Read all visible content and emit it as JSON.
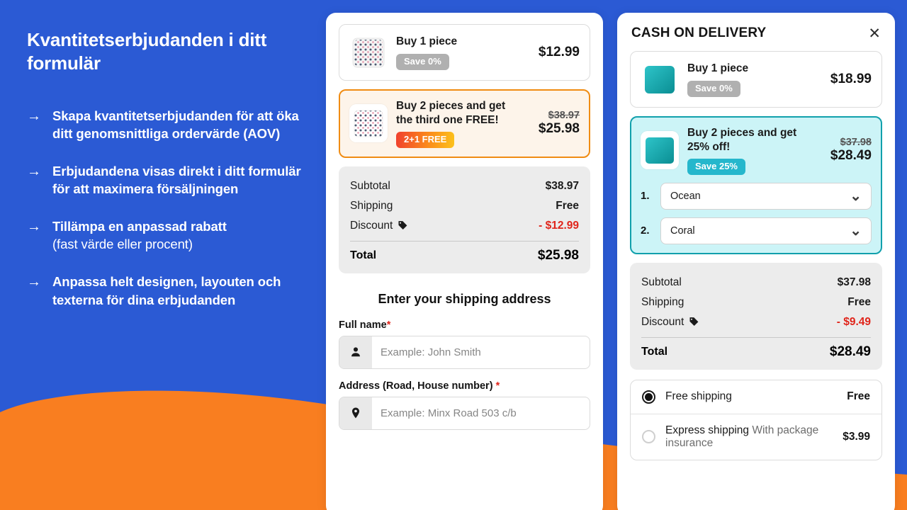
{
  "promo": {
    "title": "Kvantitetserbjudanden i ditt formulär",
    "items": [
      {
        "arrow": "→",
        "text": "Skapa kvantitetserbjudanden för att öka ditt genomsnittliga ordervärde (AOV)",
        "sub": ""
      },
      {
        "arrow": "→",
        "text": "Erbjudandena visas direkt i ditt formulär för att maximera försäljningen",
        "sub": ""
      },
      {
        "arrow": "→",
        "text": "Tillämpa en anpassad rabatt",
        "sub": "(fast värde eller procent)"
      },
      {
        "arrow": "→",
        "text": "Anpassa helt designen, layouten och texterna för dina erbjudanden",
        "sub": ""
      }
    ]
  },
  "colors": {
    "background_blue": "#2b5ad4",
    "background_orange": "#f97e20",
    "accent_orange": "#f08c13",
    "accent_teal": "#11a0ac",
    "discount_red": "#e0251b"
  },
  "middle_panel": {
    "offers": [
      {
        "title": "Buy 1 piece",
        "badge": "Save 0%",
        "badge_style": "grey",
        "price_old": "",
        "price": "$12.99",
        "thumb": "pillow-white-dots",
        "selected": false
      },
      {
        "title": "Buy 2 pieces and get the third one FREE!",
        "badge": "2+1 FREE",
        "badge_style": "fire",
        "price_old": "$38.97",
        "price": "$25.98",
        "thumb": "pillow-white-dots",
        "selected": true
      }
    ],
    "totals": {
      "subtotal_label": "Subtotal",
      "subtotal_value": "$38.97",
      "shipping_label": "Shipping",
      "shipping_value": "Free",
      "discount_label": "Discount",
      "discount_icon": "price-tag-icon",
      "discount_value": "- $12.99",
      "total_label": "Total",
      "total_value": "$25.98"
    },
    "form": {
      "heading": "Enter your shipping address",
      "fields": [
        {
          "label": "Full name",
          "required": "*",
          "icon": "person-icon",
          "placeholder": "Example: John Smith",
          "value": ""
        },
        {
          "label": "Address (Road, House number)",
          "required": "*",
          "icon": "location-pin-icon",
          "placeholder": "Example: Minx Road 503 c/b",
          "value": ""
        }
      ]
    }
  },
  "right_panel": {
    "title": "CASH ON DELIVERY",
    "close_icon": "close-icon",
    "offers": [
      {
        "title": "Buy 1 piece",
        "badge": "Save 0%",
        "badge_style": "grey",
        "price_old": "",
        "price": "$18.99",
        "thumb": "pillow-teal",
        "selected": false
      },
      {
        "title": "Buy 2 pieces and get 25% off!",
        "badge": "Save 25%",
        "badge_style": "teal",
        "price_old": "$37.98",
        "price": "$28.49",
        "thumb": "pillow-teal",
        "selected": true
      }
    ],
    "variants": [
      {
        "num": "1.",
        "value": "Ocean"
      },
      {
        "num": "2.",
        "value": "Coral"
      }
    ],
    "totals": {
      "subtotal_label": "Subtotal",
      "subtotal_value": "$37.98",
      "shipping_label": "Shipping",
      "shipping_value": "Free",
      "discount_label": "Discount",
      "discount_icon": "price-tag-icon",
      "discount_value": "- $9.49",
      "total_label": "Total",
      "total_value": "$28.49"
    },
    "shipping_methods": [
      {
        "label": "Free shipping",
        "sub": "",
        "price": "Free",
        "selected": true
      },
      {
        "label": "Express shipping",
        "sub": "With package insurance",
        "price": "$3.99",
        "selected": false
      }
    ]
  }
}
